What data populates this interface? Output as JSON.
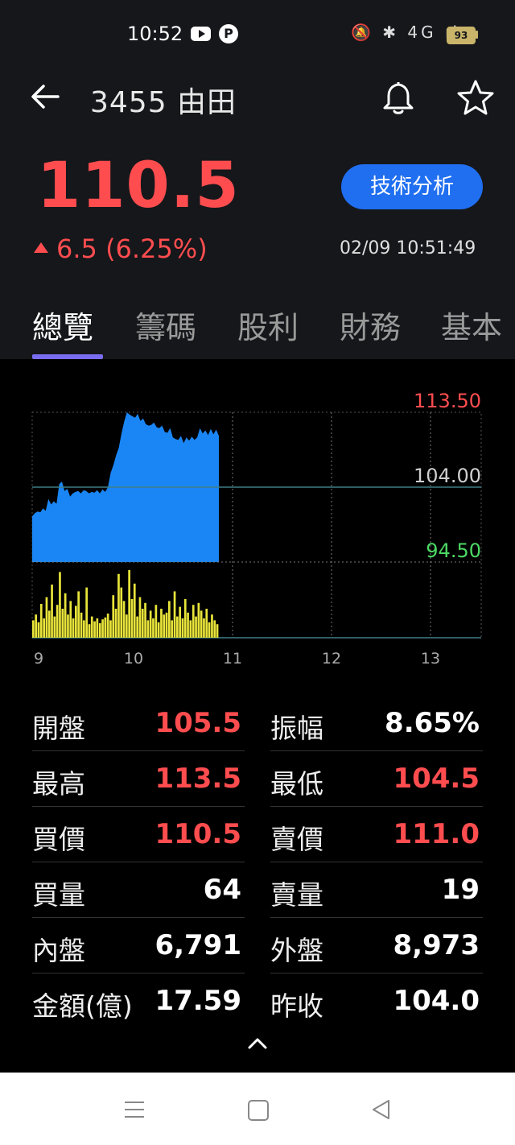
{
  "status": {
    "time": "10:52",
    "icons": "🔕 ✱ 4G ıl",
    "battery": "93"
  },
  "header": {
    "title": "3455 由田"
  },
  "quote": {
    "price": "110.5",
    "change": "6.5 (6.25%)",
    "timestamp": "02/09 10:51:49",
    "tech_button": "技術分析"
  },
  "tabs": [
    "總覽",
    "籌碼",
    "股利",
    "財務",
    "基本"
  ],
  "colors": {
    "up": "#ff4d4f",
    "down": "#4cd964",
    "accent": "#1f6ff0",
    "volume": "#e8e43a",
    "price_fill": "#1a86f5"
  },
  "chart_data": {
    "type": "area",
    "price_axis": {
      "high": 113.5,
      "ref": 104.0,
      "low": 94.5,
      "labels": [
        "113.50",
        "104.00",
        "94.50"
      ]
    },
    "x_ticks": [
      "9",
      "10",
      "11",
      "12",
      "13"
    ],
    "price": [
      100.3,
      100.7,
      100.9,
      100.8,
      101.3,
      101.0,
      102.5,
      101.8,
      102.2,
      101.9,
      104.4,
      104.7,
      103.5,
      103.8,
      102.8,
      103.2,
      103.4,
      103.5,
      103.2,
      103.6,
      103.5,
      103.2,
      103.4,
      103.3,
      103.6,
      103.2,
      103.7,
      103.4,
      104.0,
      105.8,
      106.8,
      108.0,
      109.0,
      110.8,
      112.3,
      113.5,
      113.2,
      113.0,
      112.8,
      113.3,
      112.4,
      112.7,
      112.0,
      111.8,
      111.9,
      112.2,
      111.6,
      111.5,
      111.8,
      111.0,
      110.9,
      111.5,
      110.3,
      110.1,
      110.0,
      110.5,
      109.6,
      110.3,
      109.9,
      110.4,
      110.0,
      110.3,
      111.5,
      110.8,
      111.2,
      110.6,
      111.4,
      110.7,
      111.3,
      110.5
    ],
    "volume": [
      18,
      24,
      16,
      35,
      20,
      42,
      28,
      55,
      22,
      34,
      68,
      30,
      46,
      24,
      38,
      20,
      33,
      48,
      26,
      18,
      52,
      14,
      22,
      17,
      20,
      15,
      19,
      21,
      25,
      18,
      44,
      30,
      66,
      52,
      38,
      24,
      70,
      40,
      56,
      22,
      42,
      30,
      36,
      18,
      28,
      20,
      34,
      16,
      30,
      24,
      26,
      38,
      18,
      48,
      22,
      32,
      20,
      40,
      26,
      18,
      34,
      22,
      36,
      28,
      20,
      30,
      16,
      24,
      18,
      14
    ]
  },
  "stats": [
    {
      "left_label": "開盤",
      "left_value": "105.5",
      "left_color": "red",
      "right_label": "振幅",
      "right_value": "8.65%",
      "right_color": "white"
    },
    {
      "left_label": "最高",
      "left_value": "113.5",
      "left_color": "red",
      "right_label": "最低",
      "right_value": "104.5",
      "right_color": "red"
    },
    {
      "left_label": "買價",
      "left_value": "110.5",
      "left_color": "red",
      "right_label": "賣價",
      "right_value": "111.0",
      "right_color": "red"
    },
    {
      "left_label": "買量",
      "left_value": "64",
      "left_color": "white",
      "right_label": "賣量",
      "right_value": "19",
      "right_color": "white"
    },
    {
      "left_label": "內盤",
      "left_value": "6,791",
      "left_color": "white",
      "right_label": "外盤",
      "right_value": "8,973",
      "right_color": "white"
    },
    {
      "left_label": "金額(億)",
      "left_value": "17.59",
      "left_color": "white",
      "right_label": "昨收",
      "right_value": "104.0",
      "right_color": "white"
    }
  ]
}
